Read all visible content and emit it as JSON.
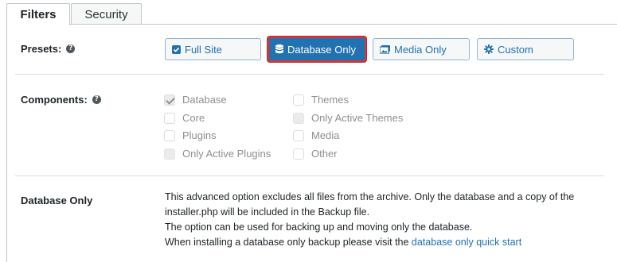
{
  "tabs": [
    {
      "label": "Filters",
      "active": true
    },
    {
      "label": "Security",
      "active": false
    }
  ],
  "presets": {
    "label": "Presets:",
    "help_icon": "?",
    "buttons": [
      {
        "label": "Full Site",
        "icon": "checkbox-icon"
      },
      {
        "label": "Database Only",
        "icon": "database-icon",
        "active": true
      },
      {
        "label": "Media Only",
        "icon": "image-icon"
      },
      {
        "label": "Custom",
        "icon": "gear-icon"
      }
    ]
  },
  "components": {
    "label": "Components:",
    "help_icon": "?",
    "items": [
      {
        "label": "Database",
        "state": "checked"
      },
      {
        "label": "Core",
        "state": "unchecked"
      },
      {
        "label": "Plugins",
        "state": "unchecked"
      },
      {
        "label": "Only Active Plugins",
        "state": "filled"
      },
      {
        "label": "Themes",
        "state": "unchecked"
      },
      {
        "label": "Only Active Themes",
        "state": "filled"
      },
      {
        "label": "Media",
        "state": "unchecked"
      },
      {
        "label": "Other",
        "state": "unchecked"
      }
    ]
  },
  "database_only": {
    "label": "Database Only",
    "line1": "This advanced option excludes all files from the archive. Only the database and a copy of the",
    "line2": "installer.php will be included in the Backup file.",
    "line3": "The option can be used for backing up and moving only the database.",
    "line4_prefix": "When installing a database only backup please visit the ",
    "line4_link": "database only quick start"
  },
  "colors": {
    "accent": "#2271b1",
    "active_border": "#d63638"
  }
}
